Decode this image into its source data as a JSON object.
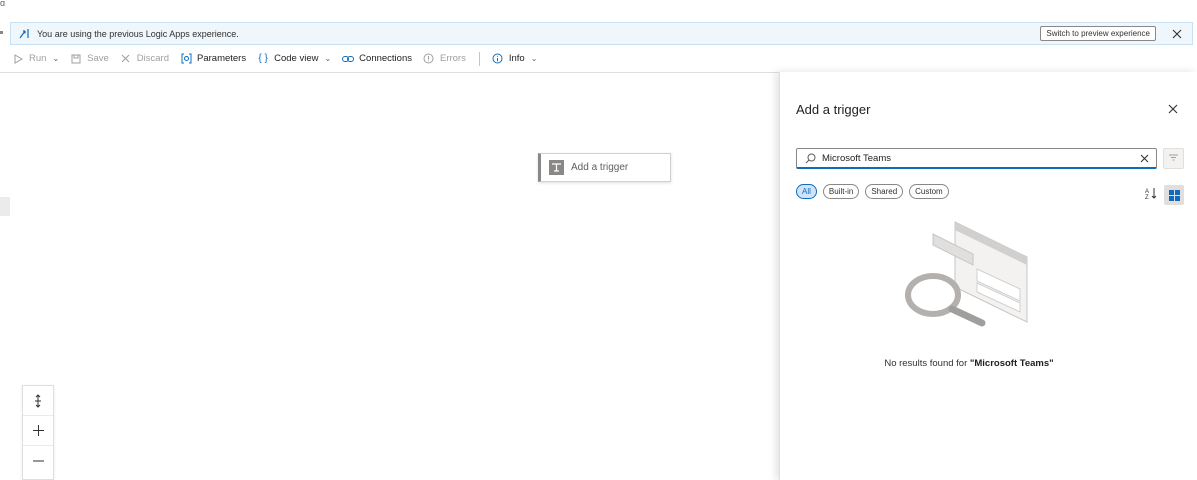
{
  "banner": {
    "message": "You are using the previous Logic Apps experience.",
    "switch_button": "Switch to preview experience",
    "icons": {
      "leading": "preview-arrow-icon",
      "close": "close-icon"
    }
  },
  "toolbar": {
    "items": [
      {
        "label": "Run",
        "icon": "play-icon",
        "has_menu": true,
        "enabled": false
      },
      {
        "label": "Save",
        "icon": "save-icon",
        "has_menu": false,
        "enabled": false
      },
      {
        "label": "Discard",
        "icon": "discard-icon",
        "has_menu": false,
        "enabled": false
      },
      {
        "label": "Parameters",
        "icon": "parameters-icon",
        "has_menu": false,
        "enabled": true
      },
      {
        "label": "Code view",
        "icon": "code-braces-icon",
        "has_menu": true,
        "enabled": true
      },
      {
        "label": "Connections",
        "icon": "link-icon",
        "has_menu": false,
        "enabled": true
      },
      {
        "label": "Errors",
        "icon": "error-circle-icon",
        "has_menu": false,
        "enabled": false
      },
      {
        "label": "Info",
        "icon": "info-icon",
        "has_menu": true,
        "enabled": true
      }
    ]
  },
  "canvas": {
    "trigger_node_label": "Add a trigger",
    "zoom_controls": [
      "fit-view-icon",
      "zoom-in-icon",
      "zoom-out-icon"
    ]
  },
  "panel": {
    "title": "Add a trigger",
    "search": {
      "value": "Microsoft Teams",
      "placeholder": "Search"
    },
    "filters": [
      {
        "label": "All",
        "active": true
      },
      {
        "label": "Built-in",
        "active": false
      },
      {
        "label": "Shared",
        "active": false
      },
      {
        "label": "Custom",
        "active": false
      }
    ],
    "no_results_prefix": "No results found for ",
    "no_results_query": "\"Microsoft Teams\""
  },
  "colors": {
    "accent": "#0f6cbd",
    "banner_bg": "#eff6fc",
    "disabled_text": "#a19f9d"
  }
}
